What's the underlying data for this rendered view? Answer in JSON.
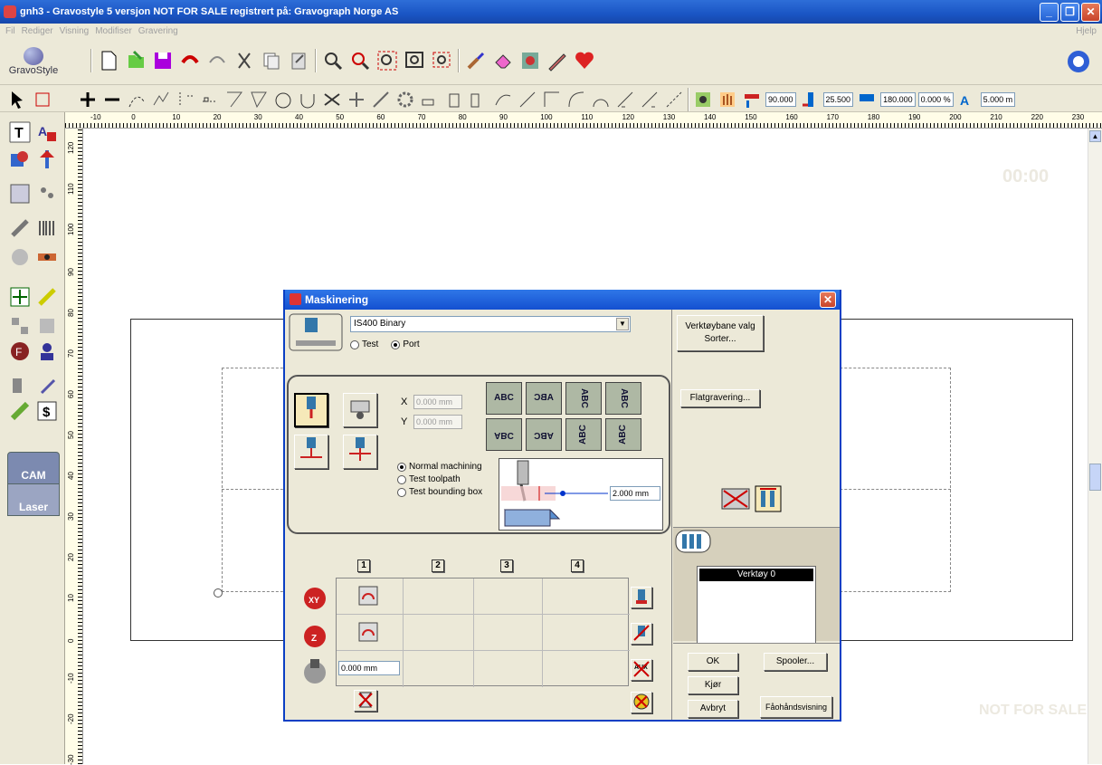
{
  "titlebar": {
    "title": "gnh3 - Gravostyle 5  versjon NOT FOR SALE registrert på: Gravograph Norge AS"
  },
  "menu": {
    "items": [
      "Fil",
      "Rediger",
      "Visning",
      "Modifiser",
      "Gravering"
    ],
    "help": "Hjelp"
  },
  "logo": {
    "text": "GravoStyle"
  },
  "toolbar2": {
    "angle": "90.000",
    "height": "25.500",
    "width": "180.000",
    "percent": "0.000 %",
    "size": "5.000 m"
  },
  "ruler": {
    "h_ticks": [
      "-10",
      "0",
      "10",
      "20",
      "30",
      "40",
      "50",
      "60",
      "70",
      "80",
      "90",
      "100",
      "110",
      "120",
      "130",
      "140",
      "150",
      "160",
      "170",
      "180",
      "190",
      "200",
      "210",
      "220",
      "230"
    ],
    "v_ticks": [
      "120",
      "110",
      "100",
      "90",
      "80",
      "70",
      "60",
      "50",
      "40",
      "30",
      "20",
      "10",
      "0",
      "-10",
      "-20",
      "-30"
    ]
  },
  "sidepanel": {
    "cam_label": "CAM",
    "laser_label": "Laser"
  },
  "canvas": {
    "timer": "00:00",
    "watermark": "NOT FOR SALE"
  },
  "dialog": {
    "title": "Maskinering",
    "machine": "IS400 Binary",
    "output_test": "Test",
    "output_port": "Port",
    "x_label": "X",
    "y_label": "Y",
    "x_value": "0.000 mm",
    "y_value": "0.000 mm",
    "tiles": [
      "ABC",
      "ABC",
      "ABC",
      "ABC",
      "ABC",
      "ABC",
      "ABC",
      "ABC"
    ],
    "mode_normal": "Normal machining",
    "mode_toolpath": "Test toolpath",
    "mode_bbox": "Test bounding box",
    "depth_value": "2.000 mm",
    "columns": [
      "1",
      "2",
      "3",
      "4"
    ],
    "offset_value": "0.000 mm",
    "toolpath_btn": "Verktøybane valg",
    "sort_btn": "Sorter...",
    "flat_btn": "Flatgravering...",
    "tool_item": "Verktøy 0",
    "ok_btn": "OK",
    "spooler_btn": "Spooler...",
    "run_btn": "Kjør",
    "cancel_btn": "Avbryt",
    "preview_btn": "Fåohåndsvisning"
  }
}
